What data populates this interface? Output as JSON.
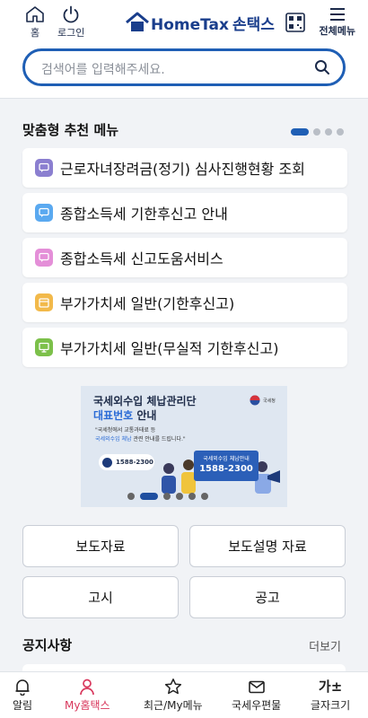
{
  "header": {
    "home_label": "홈",
    "login_label": "로그인",
    "logo_en": "HomeTax",
    "logo_ko": "손택스",
    "menu_label": "전체메뉴"
  },
  "search": {
    "placeholder": "검색어를 입력해주세요."
  },
  "recommend": {
    "title": "맞춤형 추천 메뉴",
    "page_count": 4,
    "active_page": 1,
    "items": [
      {
        "label": "근로자녀장려금(정기) 심사진행현황 조회",
        "icon": "chat-icon",
        "color": "#8b7fd0"
      },
      {
        "label": "종합소득세 기한후신고 안내",
        "icon": "chat-icon",
        "color": "#5aa9f0"
      },
      {
        "label": "종합소득세 신고도움서비스",
        "icon": "chat-icon",
        "color": "#e48fd8"
      },
      {
        "label": "부가가치세 일반(기한후신고)",
        "icon": "calendar-icon",
        "color": "#f2b94a"
      },
      {
        "label": "부가가치세 일반(무실적 기한후신고)",
        "icon": "monitor-icon",
        "color": "#7cc04a"
      }
    ]
  },
  "banner": {
    "title_line1": "국세외수입 체납관리단",
    "title_highlight": "대표번호",
    "title_rest": " 안내",
    "desc_line1": "\"국세청에서 교통과태료 등",
    "desc_highlight": "국세외수입 체납",
    "desc_rest": " 관련 안내를 드립니다.\"",
    "agency": "국세청",
    "phone": "1588-2300",
    "card_title": "국세외수입 체납안내",
    "card_phone": "1588-2300",
    "slide_count": 6,
    "active_slide": 2
  },
  "grid": {
    "press": "보도자료",
    "press_explain": "보도설명 자료",
    "notice_law": "고시",
    "announce": "공고"
  },
  "notice": {
    "title": "공지사항",
    "more": "더보기"
  },
  "bottom_nav": {
    "alarm": "알림",
    "my": "My홈택스",
    "recent": "최근/My메뉴",
    "post": "국세우편물",
    "font_glyph": "가±",
    "font": "글자크기"
  },
  "colors": {
    "brand": "#1a3e8c",
    "accent": "#1f5fb5",
    "active_nav": "#d8365b"
  }
}
